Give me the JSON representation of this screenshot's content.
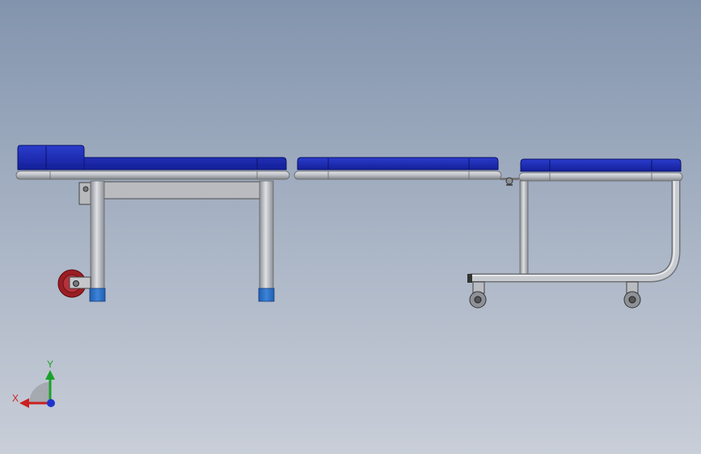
{
  "viewport": {
    "background_top": "#8294ad",
    "background_bottom": "#c9ced8"
  },
  "colors": {
    "cushion": "#2233b8",
    "cushion_dark": "#0f1a7a",
    "frame_tube": "#c3c6cb",
    "leg_cap": "#2f6fc4",
    "wheel": "#9a1e24"
  },
  "triad": {
    "x_label": "X",
    "y_label": "Y",
    "x_color": "#cc1f1f",
    "y_color": "#1aa12a",
    "z_color": "#1f33cc"
  }
}
